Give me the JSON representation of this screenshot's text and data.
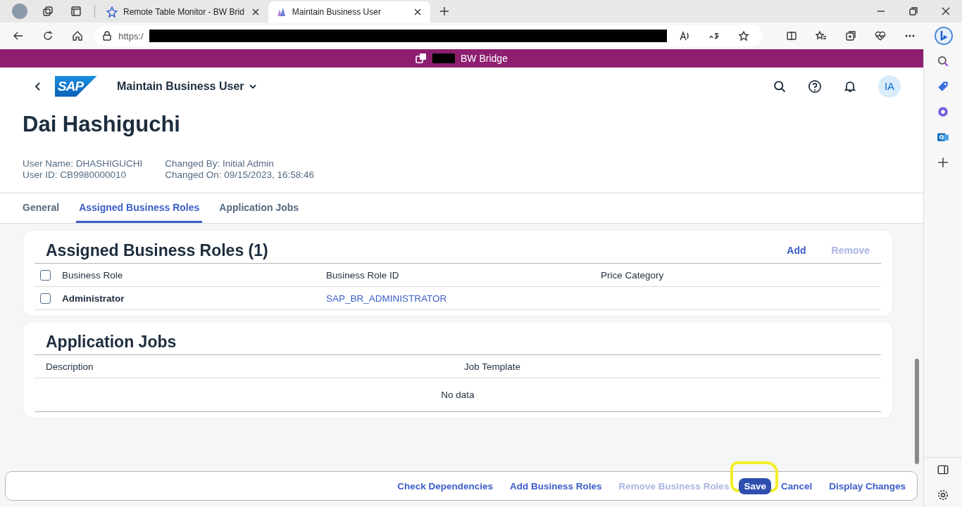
{
  "browser": {
    "tabs": [
      {
        "title": "Remote Table Monitor - BW Brid",
        "selected": false
      },
      {
        "title": "Maintain Business User",
        "selected": true
      }
    ],
    "address": "https:/"
  },
  "banner": {
    "title": "BW Bridge"
  },
  "shell": {
    "logo": "SAP",
    "app_title": "Maintain Business User",
    "avatar": "IA"
  },
  "header": {
    "name": "Dai Hashiguchi",
    "attribute_groups": [
      [
        "User Name: DHASHIGUCHI",
        "User ID: CB9980000010"
      ],
      [
        "Changed By: Initial Admin",
        "Changed On: 09/15/2023, 16:58:46"
      ]
    ]
  },
  "tabs": [
    {
      "label": "General",
      "selected": false
    },
    {
      "label": "Assigned Business Roles",
      "selected": true
    },
    {
      "label": "Application Jobs",
      "selected": false
    }
  ],
  "roles": {
    "title": "Assigned Business Roles (1)",
    "select_all_checked": false,
    "actions": [
      {
        "label": "Add",
        "disabled": false
      },
      {
        "label": "Remove",
        "disabled": true
      }
    ],
    "columns": [
      "Business Role",
      "Business Role ID",
      "Price Category"
    ],
    "rows": [
      {
        "role": "Administrator",
        "role_id": "SAP_BR_ADMINISTRATOR",
        "checked": false
      }
    ]
  },
  "jobs": {
    "title": "Application Jobs",
    "columns": [
      "Description",
      "Job Template"
    ],
    "empty_text": "No data"
  },
  "footer": {
    "actions": [
      {
        "label": "Check Dependencies",
        "kind": "link",
        "disabled": false,
        "highlighted": false
      },
      {
        "label": "Add Business Roles",
        "kind": "link",
        "disabled": false,
        "highlighted": false
      },
      {
        "label": "Remove Business Roles",
        "kind": "link",
        "disabled": true,
        "highlighted": false
      },
      {
        "label": "Save",
        "kind": "emphasized",
        "disabled": false,
        "highlighted": true
      },
      {
        "label": "Cancel",
        "kind": "link",
        "disabled": false,
        "highlighted": false
      },
      {
        "label": "Display Changes",
        "kind": "link",
        "disabled": false,
        "highlighted": false
      }
    ]
  }
}
